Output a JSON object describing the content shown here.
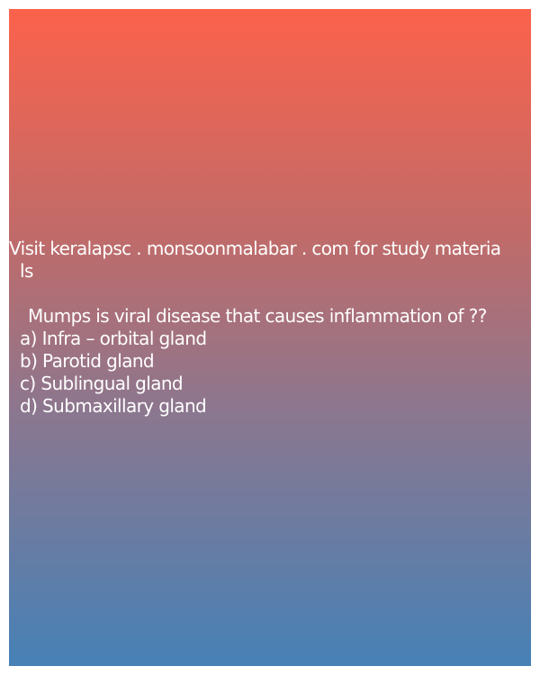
{
  "header": {
    "line1": "Visit keralapsc . monsoonmalabar . com for study materia",
    "line2": "ls"
  },
  "question": {
    "text": "Mumps is viral disease that causes inflammation of ??",
    "options": [
      "a) Infra – orbital gland",
      "b) Parotid gland",
      "c) Sublingual gland",
      "d) Submaxillary gland"
    ]
  }
}
